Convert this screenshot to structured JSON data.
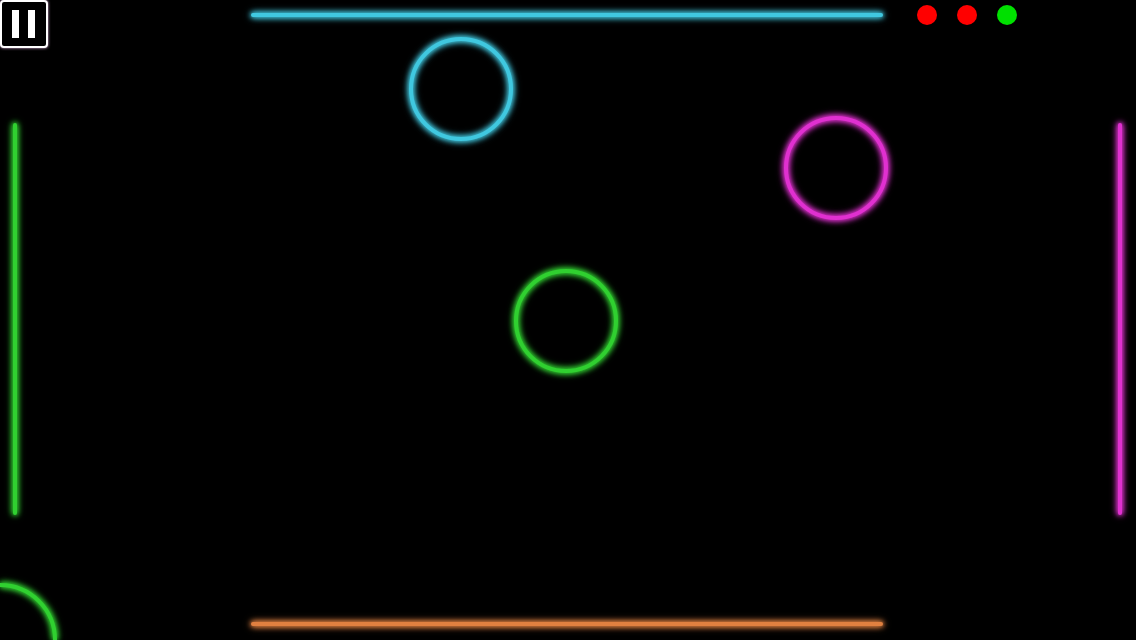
{
  "lives": [
    {
      "color": "#ff0000"
    },
    {
      "color": "#ff0000"
    },
    {
      "color": "#00e000"
    }
  ],
  "walls": [
    {
      "color": "#40c8e0"
    },
    {
      "color": "#e08040"
    },
    {
      "color": "#30d030"
    },
    {
      "color": "#e030d0"
    }
  ],
  "pucks": [
    {
      "color": "#40c8e0"
    },
    {
      "color": "#e030d0"
    },
    {
      "color": "#30d030"
    },
    {
      "color": "#30d030"
    }
  ]
}
